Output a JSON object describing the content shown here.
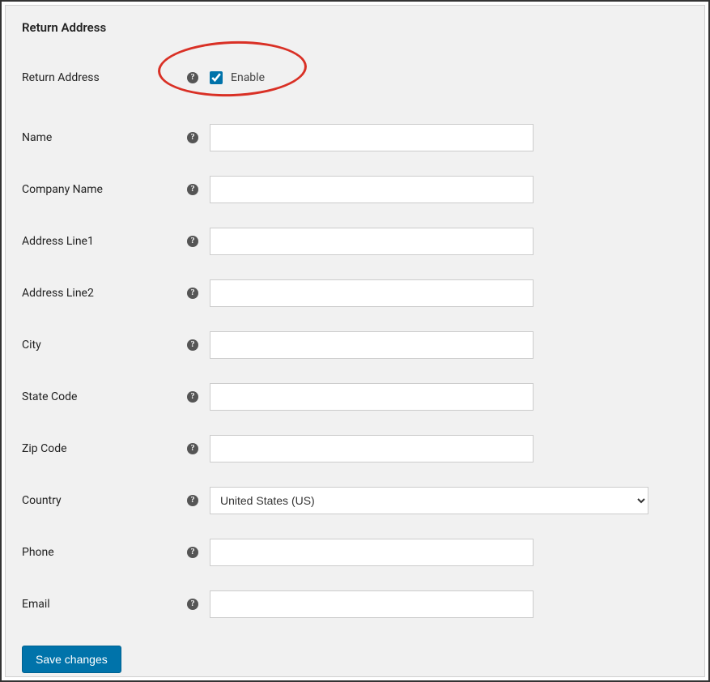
{
  "section": {
    "title": "Return Address"
  },
  "fields": {
    "return_address": {
      "label": "Return Address",
      "enable_label": "Enable",
      "checked": true
    },
    "name": {
      "label": "Name",
      "value": ""
    },
    "company_name": {
      "label": "Company Name",
      "value": ""
    },
    "address_line1": {
      "label": "Address Line1",
      "value": ""
    },
    "address_line2": {
      "label": "Address Line2",
      "value": ""
    },
    "city": {
      "label": "City",
      "value": ""
    },
    "state_code": {
      "label": "State Code",
      "value": ""
    },
    "zip_code": {
      "label": "Zip Code",
      "value": ""
    },
    "country": {
      "label": "Country",
      "selected": "United States (US)"
    },
    "phone": {
      "label": "Phone",
      "value": ""
    },
    "email": {
      "label": "Email",
      "value": ""
    }
  },
  "buttons": {
    "save": "Save changes"
  },
  "icons": {
    "help_glyph": "?"
  }
}
